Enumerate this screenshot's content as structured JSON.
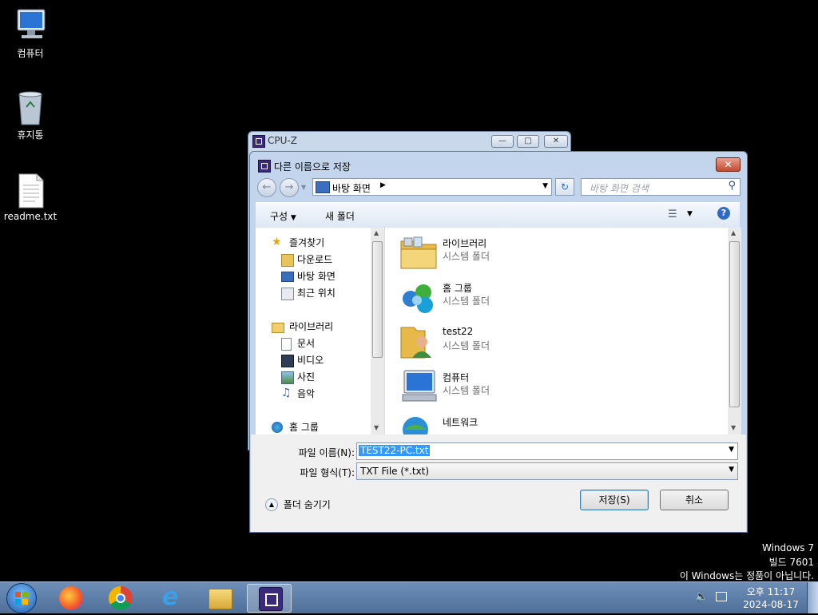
{
  "desktop": {
    "icons": [
      {
        "label": "컴퓨터"
      },
      {
        "label": "휴지통"
      },
      {
        "label": "readme.txt"
      }
    ]
  },
  "cpuz_window": {
    "title": "CPU-Z"
  },
  "dialog": {
    "title": "다른 이름으로 저장",
    "address": "바탕 화면",
    "search_placeholder": "바탕 화면 검색",
    "toolbar": {
      "organize": "구성",
      "new_folder": "새 폴더"
    },
    "nav": {
      "favorites": "즐겨찾기",
      "downloads": "다운로드",
      "desktop": "바탕 화면",
      "recent": "최근 위치",
      "libraries": "라이브러리",
      "documents": "문서",
      "videos": "비디오",
      "pictures": "사진",
      "music": "음악",
      "homegroup": "홈 그룹"
    },
    "files": [
      {
        "name": "라이브러리",
        "type": "시스템 폴더"
      },
      {
        "name": "홈 그룹",
        "type": "시스템 폴더"
      },
      {
        "name": "test22",
        "type": "시스템 폴더"
      },
      {
        "name": "컴퓨터",
        "type": "시스템 폴더"
      },
      {
        "name": "네트워크",
        "type": ""
      }
    ],
    "filename_label": "파일 이름(N):",
    "filename_value": "TEST22-PC.txt",
    "filetype_label": "파일 형식(T):",
    "filetype_value": "TXT File (*.txt)",
    "hide_folders": "폴더 숨기기",
    "save_button": "저장(S)",
    "cancel_button": "취소"
  },
  "watermark": {
    "line1": "Windows 7",
    "line2": "빌드 7601",
    "line3": "이 Windows는 정품이 아닙니다."
  },
  "clock": {
    "time": "오후 11:17",
    "date": "2024-08-17"
  },
  "colors": {
    "taskbar": "#5a7ba6",
    "selection": "#3399ff",
    "close_button": "#c24a30"
  }
}
